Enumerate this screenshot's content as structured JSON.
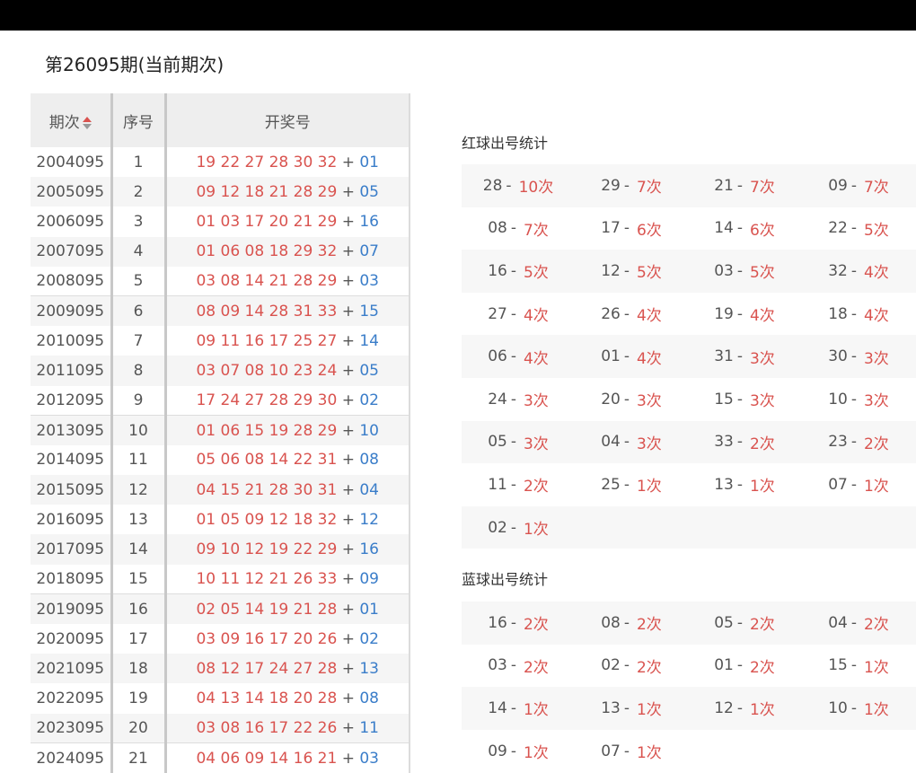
{
  "page": {
    "title": "第26095期(当前期次)"
  },
  "table": {
    "headers": {
      "period": "期次",
      "index": "序号",
      "numbers": "开奖号"
    },
    "plus": "+",
    "rows": [
      {
        "period": "2004095",
        "index": "1",
        "red": "19 22 27 28 30 32",
        "blue": "01"
      },
      {
        "period": "2005095",
        "index": "2",
        "red": "09 12 18 21 28 29",
        "blue": "05"
      },
      {
        "period": "2006095",
        "index": "3",
        "red": "01 03 17 20 21 29",
        "blue": "16"
      },
      {
        "period": "2007095",
        "index": "4",
        "red": "01 06 08 18 29 32",
        "blue": "07"
      },
      {
        "period": "2008095",
        "index": "5",
        "red": "03 08 14 21 28 29",
        "blue": "03"
      },
      {
        "period": "2009095",
        "index": "6",
        "red": "08 09 14 28 31 33",
        "blue": "15"
      },
      {
        "period": "2010095",
        "index": "7",
        "red": "09 11 16 17 25 27",
        "blue": "14"
      },
      {
        "period": "2011095",
        "index": "8",
        "red": "03 07 08 10 23 24",
        "blue": "05"
      },
      {
        "period": "2012095",
        "index": "9",
        "red": "17 24 27 28 29 30",
        "blue": "02"
      },
      {
        "period": "2013095",
        "index": "10",
        "red": "01 06 15 19 28 29",
        "blue": "10"
      },
      {
        "period": "2014095",
        "index": "11",
        "red": "05 06 08 14 22 31",
        "blue": "08"
      },
      {
        "period": "2015095",
        "index": "12",
        "red": "04 15 21 28 30 31",
        "blue": "04"
      },
      {
        "period": "2016095",
        "index": "13",
        "red": "01 05 09 12 18 32",
        "blue": "12"
      },
      {
        "period": "2017095",
        "index": "14",
        "red": "09 10 12 19 22 29",
        "blue": "16"
      },
      {
        "period": "2018095",
        "index": "15",
        "red": "10 11 12 21 26 33",
        "blue": "09"
      },
      {
        "period": "2019095",
        "index": "16",
        "red": "02 05 14 19 21 28",
        "blue": "01"
      },
      {
        "period": "2020095",
        "index": "17",
        "red": "03 09 16 17 20 26",
        "blue": "02"
      },
      {
        "period": "2021095",
        "index": "18",
        "red": "08 12 17 24 27 28",
        "blue": "13"
      },
      {
        "period": "2022095",
        "index": "19",
        "red": "04 13 14 18 20 28",
        "blue": "08"
      },
      {
        "period": "2023095",
        "index": "20",
        "red": "03 08 16 17 22 26",
        "blue": "11"
      },
      {
        "period": "2024095",
        "index": "21",
        "red": "04 06 09 14 16 21",
        "blue": "03"
      }
    ]
  },
  "red_stats": {
    "title": "红球出号统计",
    "items": [
      {
        "num": "28",
        "count": "10次"
      },
      {
        "num": "29",
        "count": "7次"
      },
      {
        "num": "21",
        "count": "7次"
      },
      {
        "num": "09",
        "count": "7次"
      },
      {
        "num": "08",
        "count": "7次"
      },
      {
        "num": "17",
        "count": "6次"
      },
      {
        "num": "14",
        "count": "6次"
      },
      {
        "num": "22",
        "count": "5次"
      },
      {
        "num": "16",
        "count": "5次"
      },
      {
        "num": "12",
        "count": "5次"
      },
      {
        "num": "03",
        "count": "5次"
      },
      {
        "num": "32",
        "count": "4次"
      },
      {
        "num": "27",
        "count": "4次"
      },
      {
        "num": "26",
        "count": "4次"
      },
      {
        "num": "19",
        "count": "4次"
      },
      {
        "num": "18",
        "count": "4次"
      },
      {
        "num": "06",
        "count": "4次"
      },
      {
        "num": "01",
        "count": "4次"
      },
      {
        "num": "31",
        "count": "3次"
      },
      {
        "num": "30",
        "count": "3次"
      },
      {
        "num": "24",
        "count": "3次"
      },
      {
        "num": "20",
        "count": "3次"
      },
      {
        "num": "15",
        "count": "3次"
      },
      {
        "num": "10",
        "count": "3次"
      },
      {
        "num": "05",
        "count": "3次"
      },
      {
        "num": "04",
        "count": "3次"
      },
      {
        "num": "33",
        "count": "2次"
      },
      {
        "num": "23",
        "count": "2次"
      },
      {
        "num": "11",
        "count": "2次"
      },
      {
        "num": "25",
        "count": "1次"
      },
      {
        "num": "13",
        "count": "1次"
      },
      {
        "num": "07",
        "count": "1次"
      },
      {
        "num": "02",
        "count": "1次"
      }
    ]
  },
  "blue_stats": {
    "title": "蓝球出号统计",
    "items": [
      {
        "num": "16",
        "count": "2次"
      },
      {
        "num": "08",
        "count": "2次"
      },
      {
        "num": "05",
        "count": "2次"
      },
      {
        "num": "04",
        "count": "2次"
      },
      {
        "num": "03",
        "count": "2次"
      },
      {
        "num": "02",
        "count": "2次"
      },
      {
        "num": "01",
        "count": "2次"
      },
      {
        "num": "15",
        "count": "1次"
      },
      {
        "num": "14",
        "count": "1次"
      },
      {
        "num": "13",
        "count": "1次"
      },
      {
        "num": "12",
        "count": "1次"
      },
      {
        "num": "10",
        "count": "1次"
      },
      {
        "num": "09",
        "count": "1次"
      },
      {
        "num": "07",
        "count": "1次"
      }
    ]
  },
  "colors": {
    "red": "#d9534f",
    "blue": "#3a7dc9",
    "header_bg": "#eeeeee",
    "topbar": "#000000"
  },
  "icons": {
    "sort": "sort-arrows-icon"
  }
}
